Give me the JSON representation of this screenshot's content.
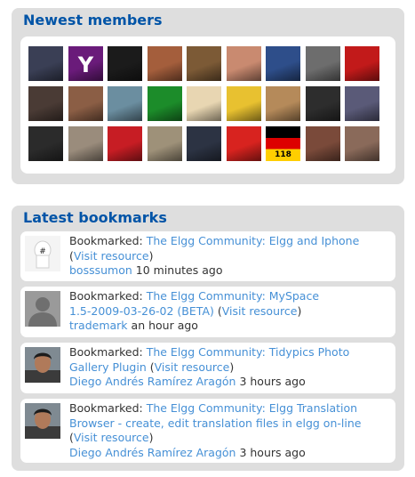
{
  "members_widget": {
    "title": "Newest members",
    "avatar_colors": [
      [
        "#3a3f55",
        "#6a1b7a",
        "#1b1b1b",
        "#a45e3c",
        "#7c5a36",
        "#c98a70",
        "#2e4e8a",
        "#6d6d6d",
        "#c21a1a"
      ],
      [
        "#4a3b35",
        "#8b5e45",
        "#6b8ea0",
        "#1c8c2a",
        "#e8d6b2",
        "#e8c130",
        "#b58a5a",
        "#2d2d2d",
        "#5a5a78"
      ],
      [
        "#2b2b2b",
        "#9a8c7c",
        "#c71d24",
        "#9e9179",
        "#2c3343",
        "#d8231f",
        "#4b3a30",
        "#7a4a3a",
        "#8a6a5a"
      ]
    ],
    "yahoo_glyph": "Y",
    "flag_text": "118"
  },
  "bookmarks_widget": {
    "title": "Latest bookmarks",
    "items": [
      {
        "prefix": "Bookmarked:",
        "title": "The Elgg Community: Elgg and Iphone",
        "open": "(",
        "visit": "Visit resource",
        "close": ")",
        "author": "bosssumon",
        "time": "10 minutes ago"
      },
      {
        "prefix": "Bookmarked:",
        "title_line1": "The Elgg Community: MySpace",
        "title_line2": "1.5-2009-03-26-02 (BETA)",
        "open": "(",
        "visit": "Visit resource",
        "close": ")",
        "author": "trademark",
        "time": "an hour ago"
      },
      {
        "prefix": "Bookmarked:",
        "title_line1": "The Elgg Community: Tidypics Photo",
        "title_line2": "Gallery Plugin",
        "open": "(",
        "visit": "Visit resource",
        "close": ")",
        "author": "Diego Andrés Ramírez Aragón",
        "time": "3 hours ago"
      },
      {
        "prefix": "Bookmarked:",
        "title_line1": "The Elgg Community: Elgg Translation",
        "title_line2": "Browser - create, edit translation files in elgg on-line",
        "open": "(",
        "visit": "Visit resource",
        "close": ")",
        "author": "Diego Andrés Ramírez Aragón",
        "time": "3 hours ago"
      }
    ]
  }
}
